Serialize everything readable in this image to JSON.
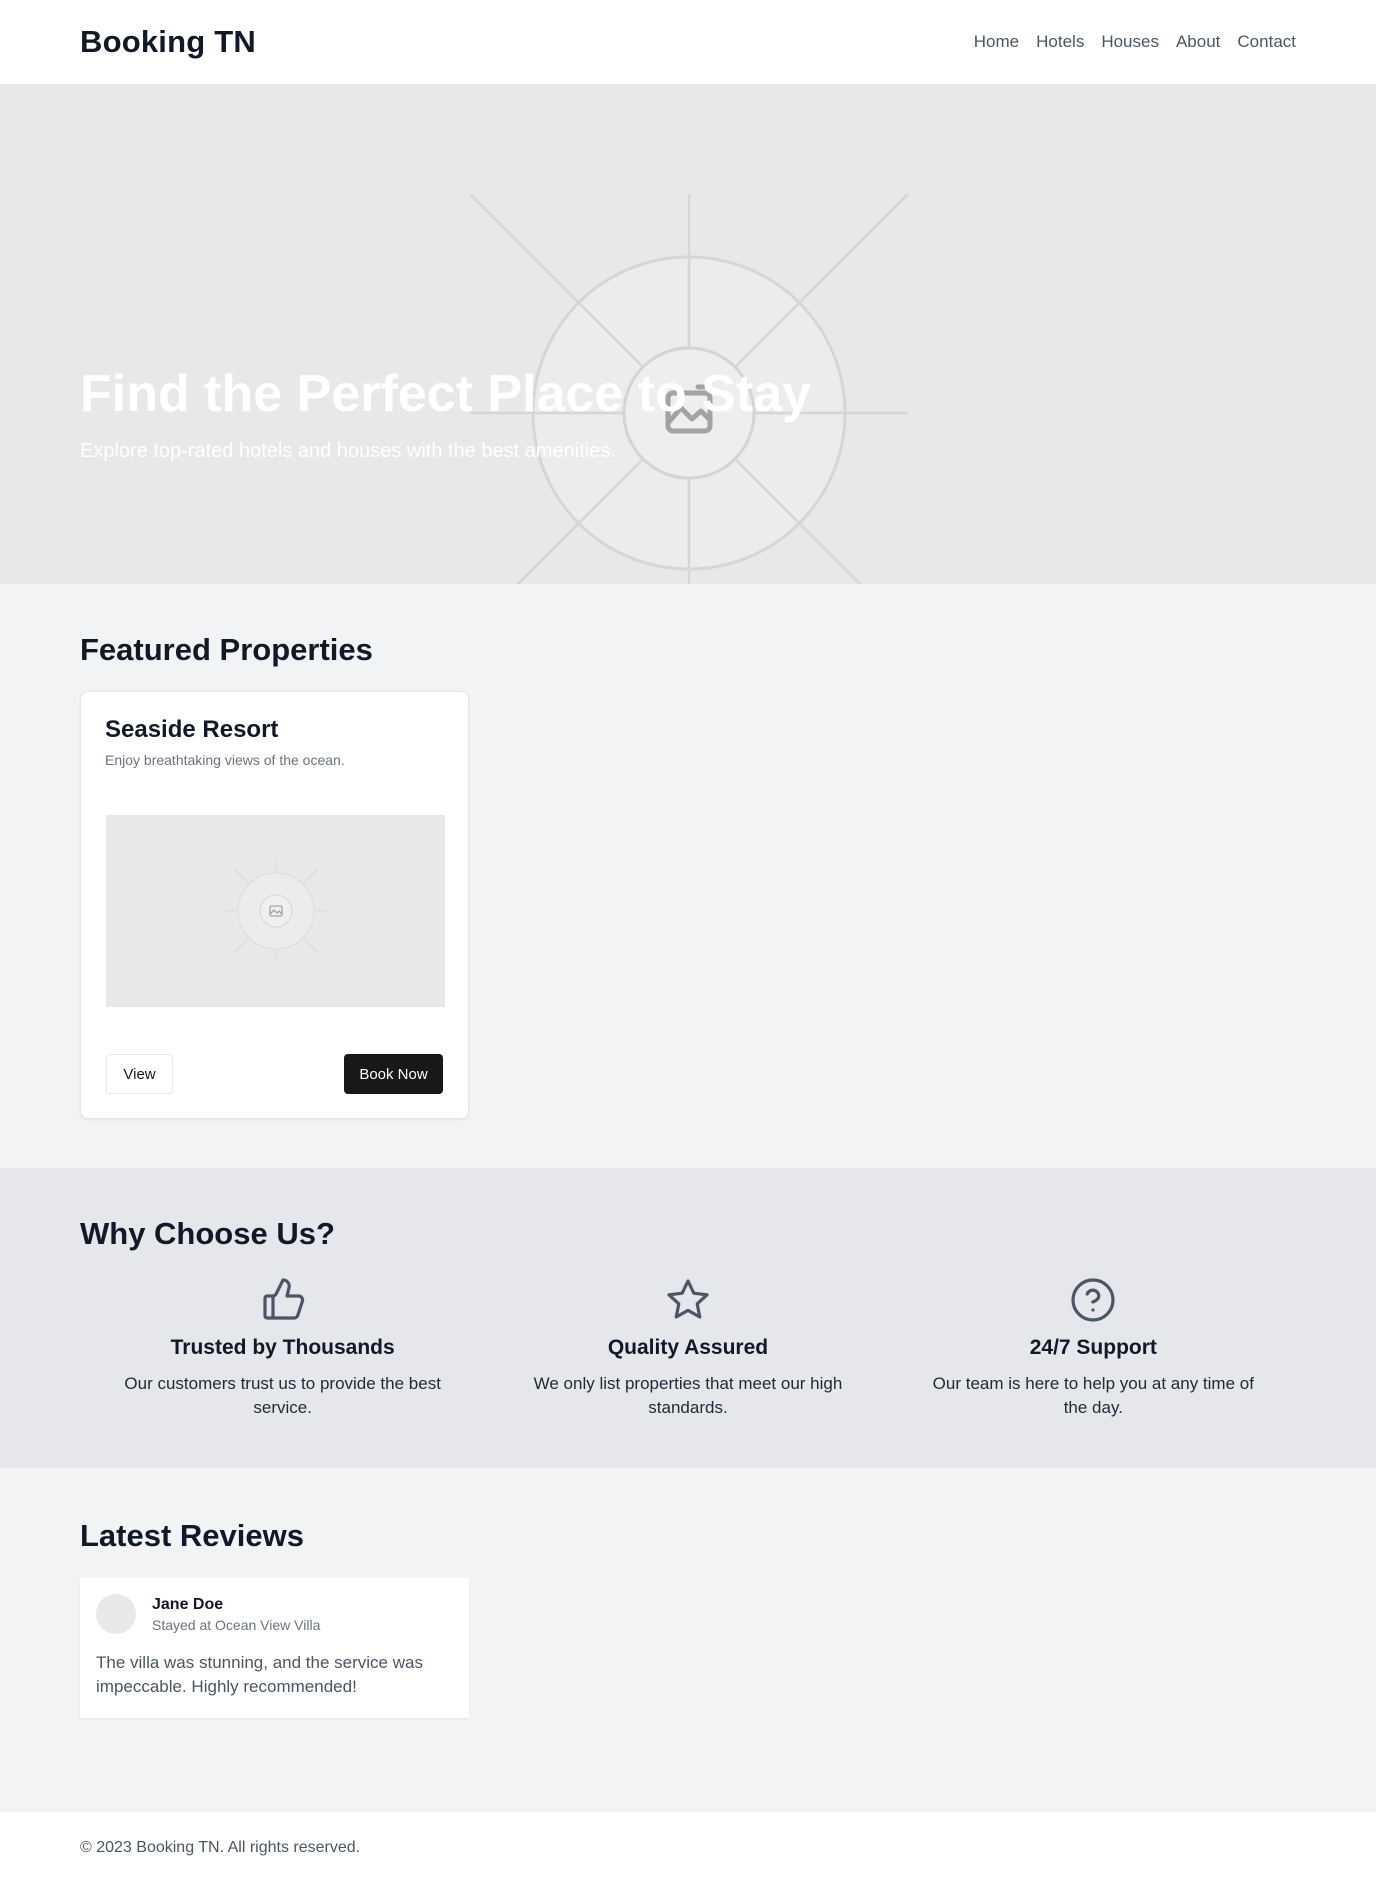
{
  "header": {
    "brand": "Booking TN",
    "nav": [
      "Home",
      "Hotels",
      "Houses",
      "About",
      "Contact"
    ]
  },
  "hero": {
    "title": "Find the Perfect Place to Stay",
    "subtitle": "Explore top-rated hotels and houses with the best amenities."
  },
  "featured": {
    "title": "Featured Properties",
    "cards": [
      {
        "name": "Seaside Resort",
        "description": "Enjoy breathtaking views of the ocean.",
        "view_label": "View",
        "book_label": "Book Now"
      }
    ]
  },
  "why": {
    "title": "Why Choose Us?",
    "features": [
      {
        "icon": "thumbs-up-icon",
        "title": "Trusted by Thousands",
        "description": "Our customers trust us to provide the best service."
      },
      {
        "icon": "star-icon",
        "title": "Quality Assured",
        "description": "We only list properties that meet our high standards."
      },
      {
        "icon": "question-circle-icon",
        "title": "24/7 Support",
        "description": "Our team is here to help you at any time of the day."
      }
    ]
  },
  "reviews": {
    "title": "Latest Reviews",
    "items": [
      {
        "name": "Jane Doe",
        "stay": "Stayed at Ocean View Villa",
        "text": "The villa was stunning, and the service was impeccable. Highly recommended!"
      }
    ]
  },
  "footer": {
    "copyright": "© 2023 Booking TN. All rights reserved."
  },
  "colors": {
    "primary_dark": "#18181b",
    "hero_bg": "#e8e8e8",
    "section_alt_bg": "#e5e7eb",
    "page_bg": "#f2f3f5"
  }
}
